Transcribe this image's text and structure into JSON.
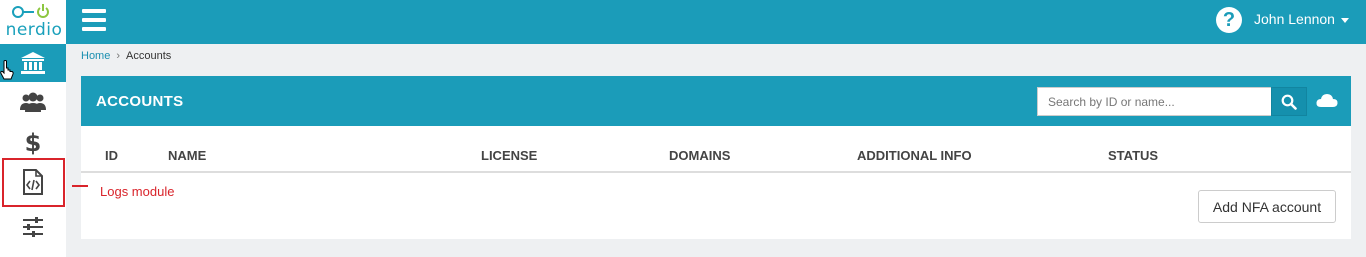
{
  "app": {
    "logo_text": "nerdio",
    "brand_color": "#1b9cb9",
    "accent_green": "#8cc63f"
  },
  "sidebar": {
    "items": [
      {
        "icon": "bank-icon",
        "active": true
      },
      {
        "icon": "users-icon",
        "active": false
      },
      {
        "icon": "dollar-icon",
        "active": false
      },
      {
        "icon": "code-file-icon",
        "active": false
      },
      {
        "icon": "sliders-icon",
        "active": false
      }
    ]
  },
  "topbar": {
    "menu_icon": "hamburger-icon",
    "help_icon_text": "?",
    "user_name": "John Lennon"
  },
  "breadcrumb": {
    "home": "Home",
    "separator": "›",
    "current": "Accounts"
  },
  "panel": {
    "title": "ACCOUNTS",
    "search_placeholder": "Search by ID or name...",
    "search_value": "",
    "columns": [
      "ID",
      "NAME",
      "LICENSE",
      "DOMAINS",
      "ADDITIONAL INFO",
      "STATUS"
    ],
    "add_button": "Add NFA account"
  },
  "annotation": {
    "label": "Logs module",
    "color": "#d9242b"
  }
}
